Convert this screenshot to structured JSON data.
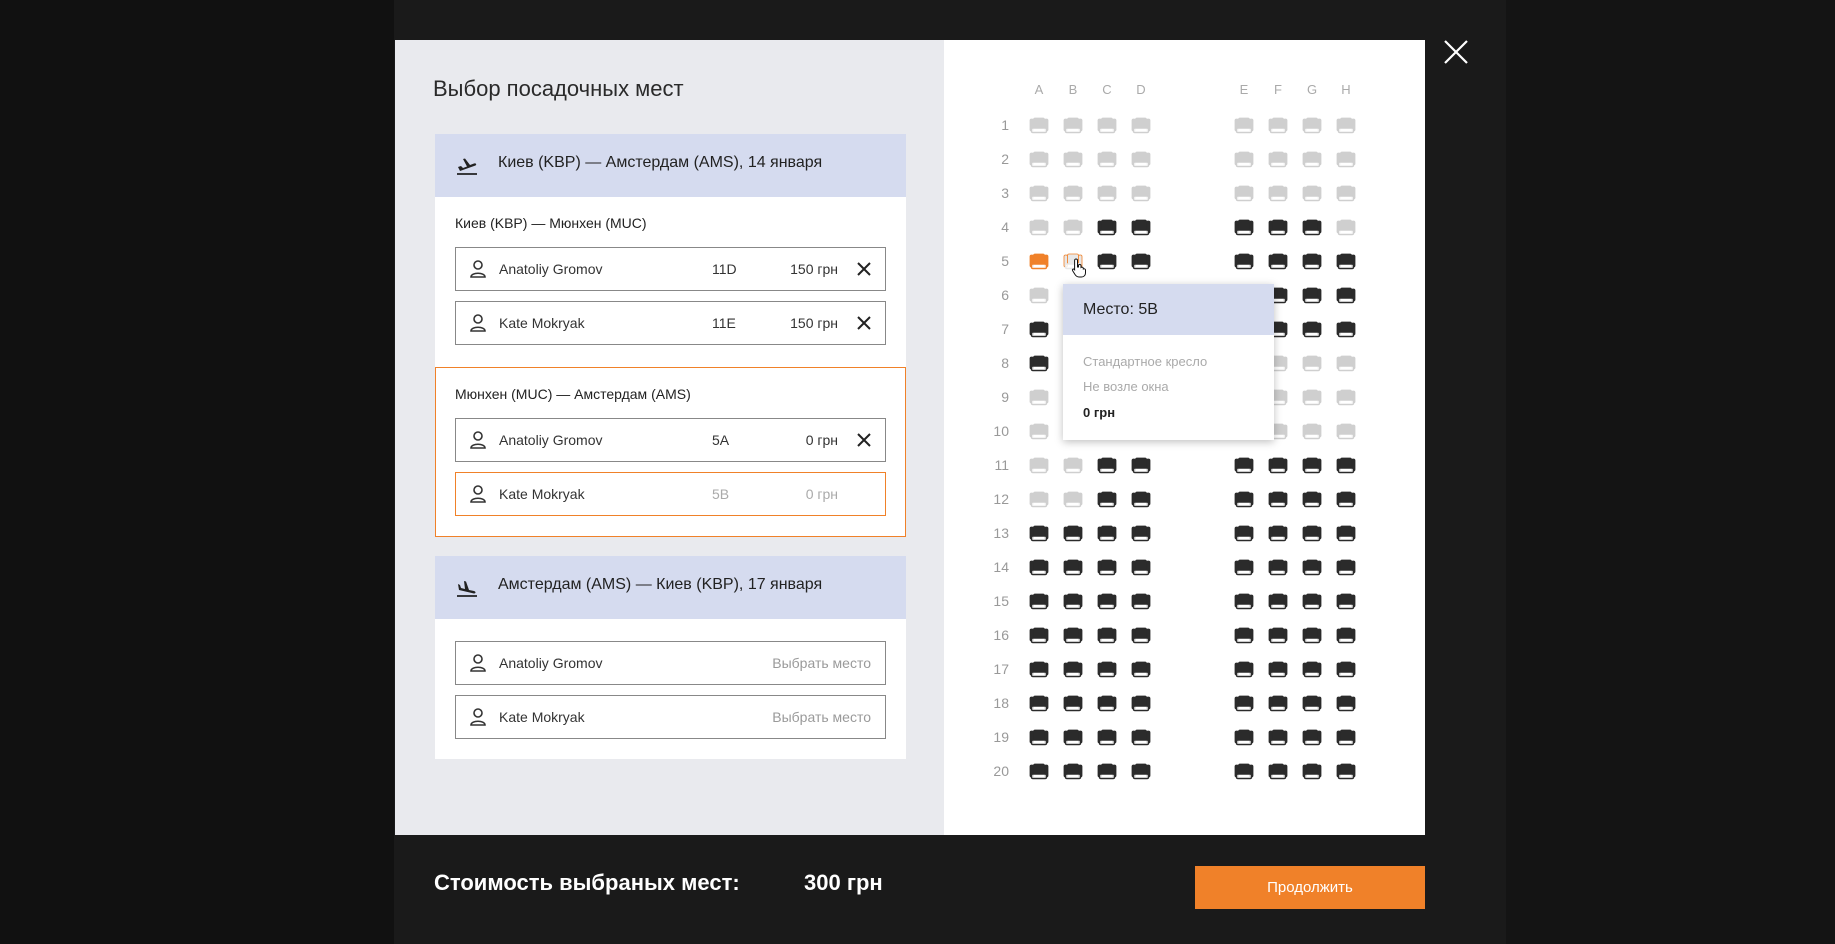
{
  "modal": {
    "title": "Выбор посадочных мест"
  },
  "outbound": {
    "title": "Киев (KBP) — Амстердам (AMS), 14 января",
    "segments": [
      {
        "title": "Киев (KBP) — Мюнхен (MUC)",
        "passengers": [
          {
            "name": "Anatoliy Gromov",
            "seat": "11D",
            "price": "150 грн"
          },
          {
            "name": "Kate Mokryak",
            "seat": "11E",
            "price": "150 грн"
          }
        ]
      },
      {
        "title": "Мюнхен (MUC) — Амстердам (AMS)",
        "passengers": [
          {
            "name": "Anatoliy Gromov",
            "seat": "5A",
            "price": "0 грн"
          },
          {
            "name": "Kate Mokryak",
            "seat": "5B",
            "price": "0 грн"
          }
        ]
      }
    ]
  },
  "return": {
    "title": "Амстердам (AMS) — Киев (KBP), 17 января",
    "passengers": [
      {
        "name": "Anatoliy Gromov",
        "action": "Выбрать место"
      },
      {
        "name": "Kate Mokryak",
        "action": "Выбрать место"
      }
    ]
  },
  "seatmap": {
    "columns": [
      "A",
      "B",
      "C",
      "D",
      "E",
      "F",
      "G",
      "H"
    ],
    "rows": [
      "1",
      "2",
      "3",
      "4",
      "5",
      "6",
      "7",
      "8",
      "9",
      "10",
      "11",
      "12",
      "13",
      "14",
      "15",
      "16",
      "17",
      "18",
      "19",
      "20"
    ],
    "legend_note": "seat codes per row for columns A-H: f=free, o=occupied, s=selected, h=hovered",
    "seats": [
      "ffffffff",
      "ffffffff",
      "ffffffff",
      "ffooooof",
      "shoooooo",
      "ffoooooo",
      "ooooooo o",
      "ooooffff",
      "ffffffff",
      "ffffffff",
      "ffoooooo",
      "ffoooooo",
      "oooooooo",
      "oooooooo",
      "oooooooo",
      "oooooooo",
      "oooooooo",
      "oooooooo",
      "oooooooo",
      "oooooooo"
    ]
  },
  "tooltip": {
    "title": "Место: 5B",
    "type": "Стандартное кресло",
    "window": "Не возле окна",
    "price": "0 грн"
  },
  "footer": {
    "label": "Стоимость выбраных мест:",
    "total": "300 грн",
    "continue_label": "Продолжить"
  },
  "colors": {
    "accent": "#f08129",
    "header_bg": "#d5dbef",
    "occupied": "#2b2b2b",
    "free": "#c8c8c8"
  }
}
